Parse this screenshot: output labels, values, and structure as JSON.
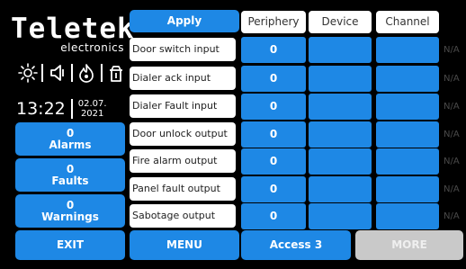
{
  "brand": {
    "name": "Teletek",
    "sub": "electronics"
  },
  "status_icons": [
    "sun-icon",
    "speaker-icon",
    "flame-icon",
    "door-icon"
  ],
  "clock": {
    "time": "13:22",
    "date_line1": "02.07.",
    "date_line2": "2021"
  },
  "side_buttons": [
    {
      "count": "0",
      "label": "Alarms"
    },
    {
      "count": "0",
      "label": "Faults"
    },
    {
      "count": "0",
      "label": "Warnings"
    }
  ],
  "apply_label": "Apply",
  "tabs": {
    "periphery": "Periphery",
    "device": "Device",
    "channel": "Channel"
  },
  "rows": [
    {
      "label": "Door switch input",
      "periphery": "0",
      "device": "",
      "channel": "",
      "status": "N/A"
    },
    {
      "label": "Dialer ack input",
      "periphery": "0",
      "device": "",
      "channel": "",
      "status": "N/A"
    },
    {
      "label": "Dialer Fault input",
      "periphery": "0",
      "device": "",
      "channel": "",
      "status": "N/A"
    },
    {
      "label": "Door unlock output",
      "periphery": "0",
      "device": "",
      "channel": "",
      "status": "N/A"
    },
    {
      "label": "Fire alarm output",
      "periphery": "0",
      "device": "",
      "channel": "",
      "status": "N/A"
    },
    {
      "label": "Panel fault output",
      "periphery": "0",
      "device": "",
      "channel": "",
      "status": "N/A"
    },
    {
      "label": "Sabotage output",
      "periphery": "0",
      "device": "",
      "channel": "",
      "status": "N/A"
    }
  ],
  "bottom": {
    "exit": "EXIT",
    "menu": "MENU",
    "access": "Access 3",
    "more": "MORE"
  },
  "colors": {
    "accent": "#1e88e5",
    "background": "#000000",
    "disabled": "#c9c9c9",
    "na_text": "#4a4a4a"
  }
}
